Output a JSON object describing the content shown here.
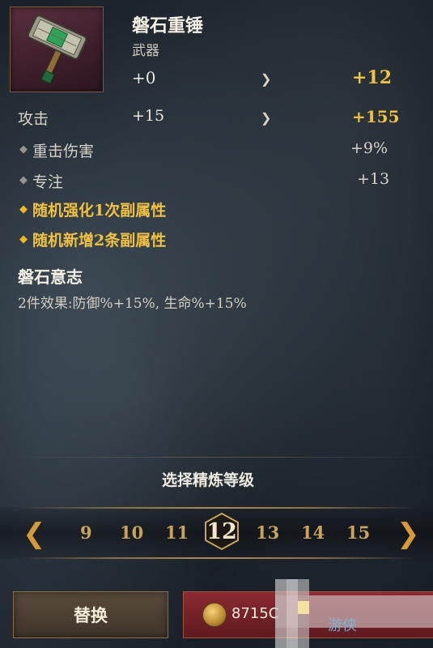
{
  "item": {
    "name": "磐石重锤",
    "type": "武器",
    "level_current": "+0",
    "level_target": "+12",
    "icon": "hammer-icon"
  },
  "stats": {
    "attack_label": "攻击",
    "attack_current": "+15",
    "attack_target": "+155",
    "sub_stats": [
      {
        "label": "重击伤害",
        "value": "+9%"
      },
      {
        "label": "专注",
        "value": "+13"
      }
    ],
    "bonuses": [
      "随机强化1次副属性",
      "随机新增2条副属性"
    ]
  },
  "set_bonus": {
    "title": "磐石意志",
    "description": "2件效果:防御%+15%, 生命%+15%"
  },
  "refine": {
    "label": "选择精炼等级",
    "levels": [
      "9",
      "10",
      "11",
      "12",
      "13",
      "14",
      "15"
    ],
    "selected": "12"
  },
  "actions": {
    "replace_label": "替换",
    "cost": "8715C"
  },
  "watermark": {
    "text": "游侠"
  },
  "colors": {
    "gold": "#f0c040",
    "refine_button": "#8a2a30",
    "item_bg": "#5a2e3e"
  }
}
